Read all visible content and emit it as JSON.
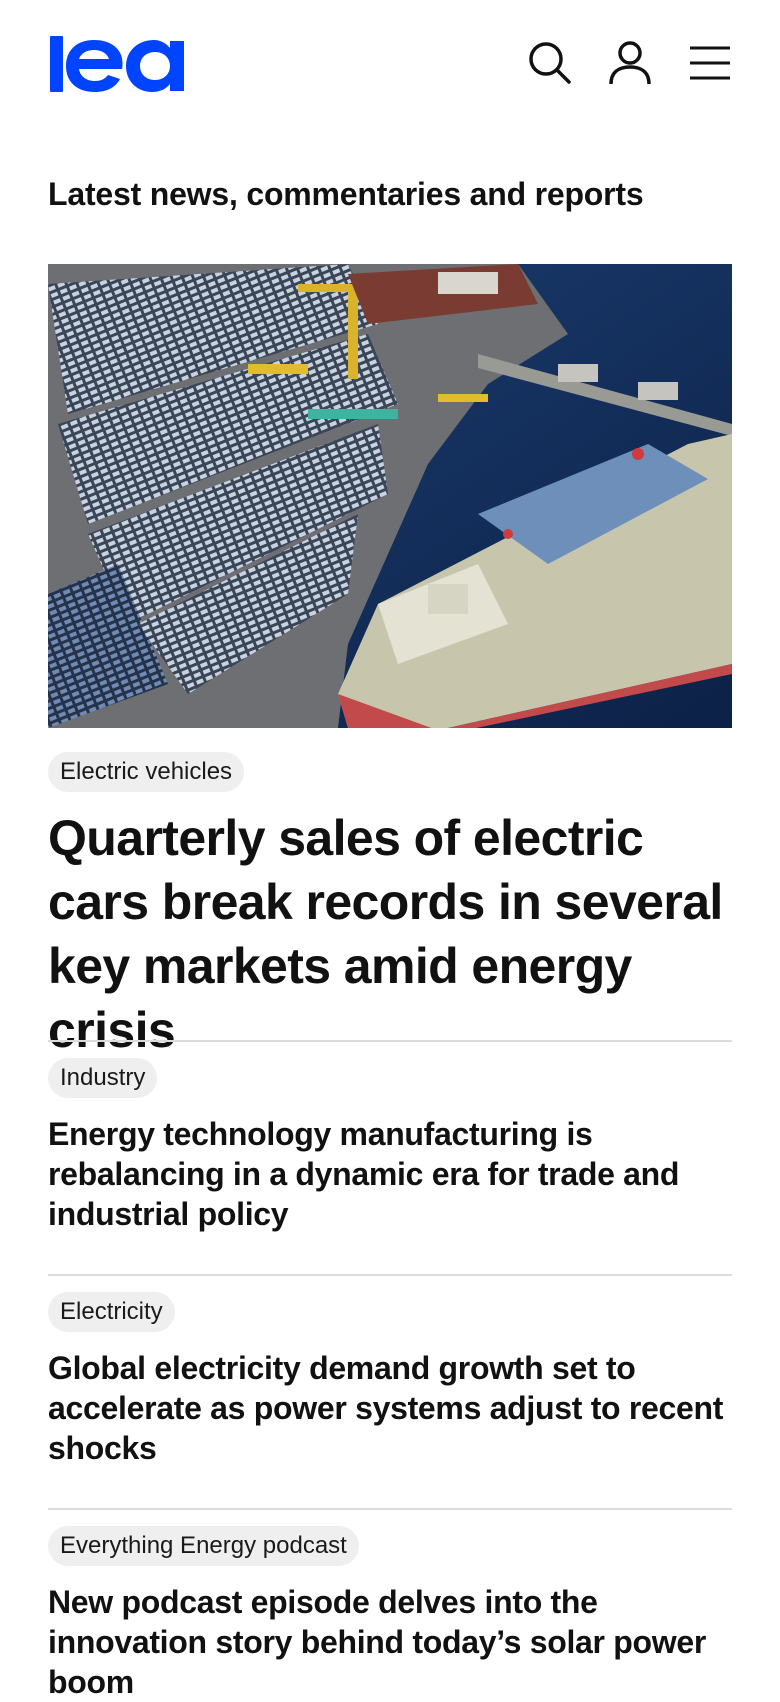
{
  "header": {
    "logo_text": "iea",
    "icons": {
      "search": "search-icon",
      "account": "user-icon",
      "menu": "menu-icon"
    },
    "brand_color": "#0044ff"
  },
  "section": {
    "title": "Latest news, commentaries and reports"
  },
  "featured": {
    "image": "aerial-port-cars-ship-image",
    "tag": "Electric vehicles",
    "headline": "Quarterly sales of electric cars break records in several key markets amid energy crisis"
  },
  "stories": [
    {
      "tag": "Industry",
      "headline": "Energy technology manufacturing is rebalancing in a dynamic era for trade and industrial policy"
    },
    {
      "tag": "Electricity",
      "headline": "Global electricity demand growth set to accelerate as power systems adjust to recent shocks"
    },
    {
      "tag": "Everything Energy podcast",
      "headline": "New podcast episode delves into the innovation story behind today’s solar power boom"
    }
  ],
  "colors": {
    "tag_background": "#efefef",
    "divider": "#dcdcdc",
    "text": "#111111"
  }
}
